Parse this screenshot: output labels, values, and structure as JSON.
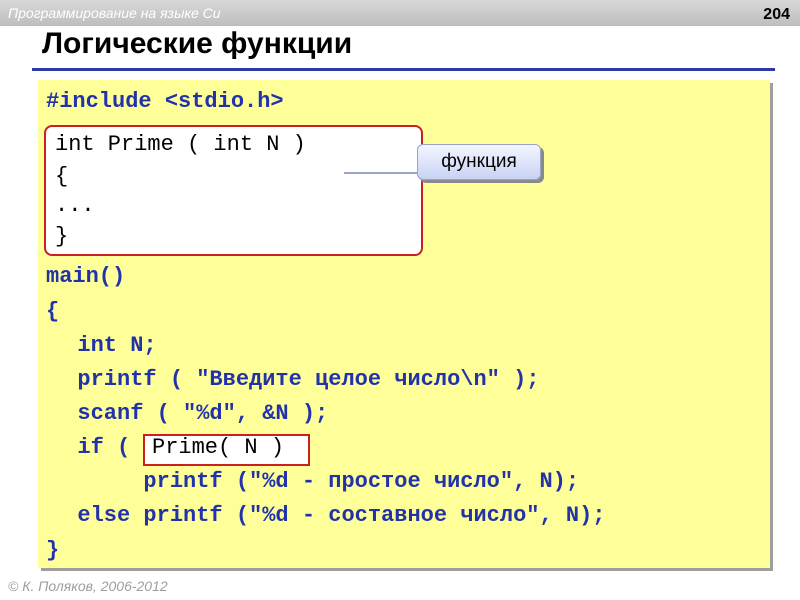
{
  "header": {
    "course": "Программирование на языке Си",
    "page_number": "204"
  },
  "slide": {
    "title": "Логические функции"
  },
  "code": {
    "include": "#include <stdio.h>",
    "func_lines": [
      "int Prime ( int N )",
      "{",
      "...",
      "}"
    ],
    "callout": "функция",
    "main_lines": [
      "main()",
      "{",
      "  int N;",
      "  printf ( \"Введите целое число\\n\" );",
      "  scanf ( \"%d\", &N );",
      "  if (           )",
      "       printf (\"%d - простое число\", N);",
      "  else printf (\"%d - составное число\", N);",
      "}"
    ],
    "highlight": "Prime( N )"
  },
  "footer": {
    "copyright": "© К. Поляков, 2006-2012"
  }
}
